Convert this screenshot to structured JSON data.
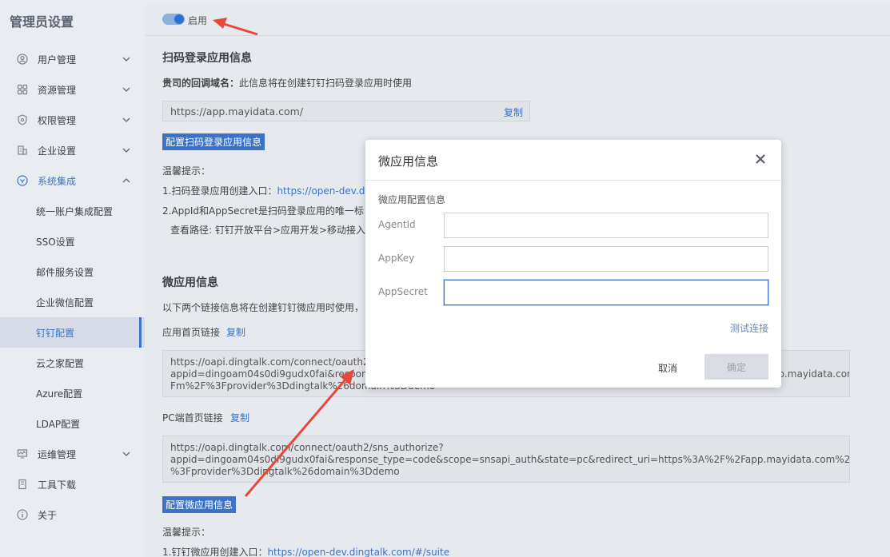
{
  "sidebar": {
    "brand": "管理员设置",
    "nav": [
      {
        "label": "用户管理",
        "icon": "user-icon",
        "expanded": false
      },
      {
        "label": "资源管理",
        "icon": "grid-icon",
        "expanded": false
      },
      {
        "label": "权限管理",
        "icon": "shield-icon",
        "expanded": false
      },
      {
        "label": "企业设置",
        "icon": "building-icon",
        "expanded": false
      },
      {
        "label": "系统集成",
        "icon": "integration-icon",
        "expanded": true
      },
      {
        "label": "运维管理",
        "icon": "monitor-icon",
        "expanded": false
      },
      {
        "label": "工具下载",
        "icon": "download-icon",
        "expanded": false
      },
      {
        "label": "关于",
        "icon": "info-icon",
        "expanded": false
      }
    ],
    "sub_items": [
      "统一账户集成配置",
      "SSO设置",
      "邮件服务设置",
      "企业微信配置",
      "钉钉配置",
      "云之家配置",
      "Azure配置",
      "LDAP配置"
    ],
    "active_sub": "钉钉配置"
  },
  "topbar": {
    "toggle_label": "启用",
    "toggle_on": true
  },
  "qr_section": {
    "title": "扫码登录应用信息",
    "callback_label": "贵司的回调域名：",
    "callback_desc": "此信息将在创建钉钉扫码登录应用时使用",
    "callback_url": "https://app.mayidata.com/",
    "copy": "复制",
    "config_button": "配置扫码登录应用信息",
    "tips_title": "温馨提示：",
    "tip1_prefix": "1.扫码登录应用创建入口：",
    "tip1_link": "https://open-dev.d",
    "tip2": "2.AppId和AppSecret是扫码登录应用的唯一标",
    "tip3": "查看路径: 钉钉开放平台>应用开发>移动接入应"
  },
  "micro_section": {
    "title": "微应用信息",
    "desc": "以下两个链接信息将在创建钉钉微应用时使用，",
    "home_label": "应用首页链接",
    "home_copy": "复制",
    "home_url_lines": [
      "https://oapi.dingtalk.com/connect/oauth2/sns_authorize?",
      "appid=dingoam04s0di9gudx0fai&response_type=code&scope=snsapi_auth&state=mobile&redirect_uri=https%3A%2F%2Fapp.mayidata.com%2",
      "Fm%2F%3Fprovider%3Ddingtalk%26domain%3Ddemo"
    ],
    "pc_label": "PC端首页链接",
    "pc_copy": "复制",
    "pc_url_lines": [
      "https://oapi.dingtalk.com/connect/oauth2/sns_authorize?",
      "appid=dingoam04s0di9gudx0fai&response_type=code&scope=snsapi_auth&state=pc&redirect_uri=https%3A%2F%2Fapp.mayidata.com%2F",
      "%3Fprovider%3Ddingtalk%26domain%3Ddemo"
    ],
    "config_button": "配置微应用信息",
    "tips_title": "温馨提示：",
    "tip1_prefix": "1.钉钉微应用创建入口：",
    "tip1_link": "https://open-dev.dingtalk.com/#/suite"
  },
  "modal": {
    "title": "微应用信息",
    "subtitle": "微应用配置信息",
    "fields": [
      {
        "label": "AgentId",
        "value": ""
      },
      {
        "label": "AppKey",
        "value": ""
      },
      {
        "label": "AppSecret",
        "value": ""
      }
    ],
    "test_link": "测试连接",
    "cancel": "取消",
    "ok": "确定"
  },
  "colors": {
    "accent": "#3a73c8",
    "annotation": "#e8473b"
  }
}
